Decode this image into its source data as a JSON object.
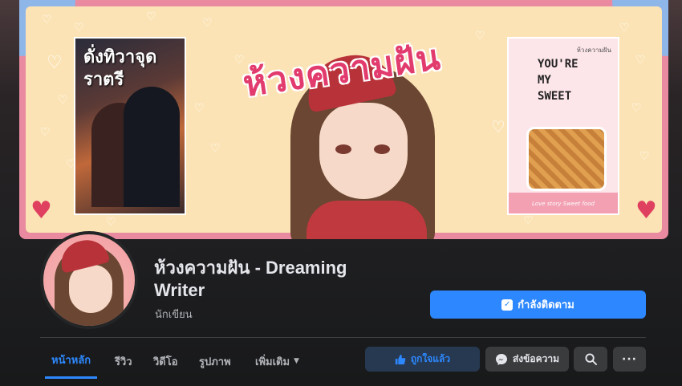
{
  "cover": {
    "title": "ห้วงความฝัน",
    "book_left_title": "ดั่งทิวาจุดราตรี",
    "book_right_author": "ห้วงความฝัน",
    "book_right_title": "YOU'RE\nMY\nSWEET",
    "book_right_tagline": "Love story Sweet food"
  },
  "profile": {
    "name": "ห้วงความฝัน - Dreaming Writer",
    "category": "นักเขียน"
  },
  "buttons": {
    "following": "กำลังติดตาม",
    "liked": "ถูกใจแล้ว",
    "message": "ส่งข้อความ",
    "more": "···"
  },
  "tabs": [
    {
      "label": "หน้าหลัก",
      "active": true
    },
    {
      "label": "รีวิว",
      "active": false
    },
    {
      "label": "วิดีโอ",
      "active": false
    },
    {
      "label": "รูปภาพ",
      "active": false
    },
    {
      "label": "เพิ่มเติม",
      "active": false
    }
  ],
  "icons": {
    "following": "check-square-icon",
    "like": "thumbs-up-icon",
    "message": "messenger-icon",
    "search": "search-icon",
    "more": "more-dots-icon",
    "tab_more": "caret-down-icon"
  },
  "colors": {
    "accent": "#2d88ff",
    "background": "#18191a",
    "surface": "#3a3b3c",
    "text": "#e4e6eb",
    "muted": "#b0b3b8"
  }
}
